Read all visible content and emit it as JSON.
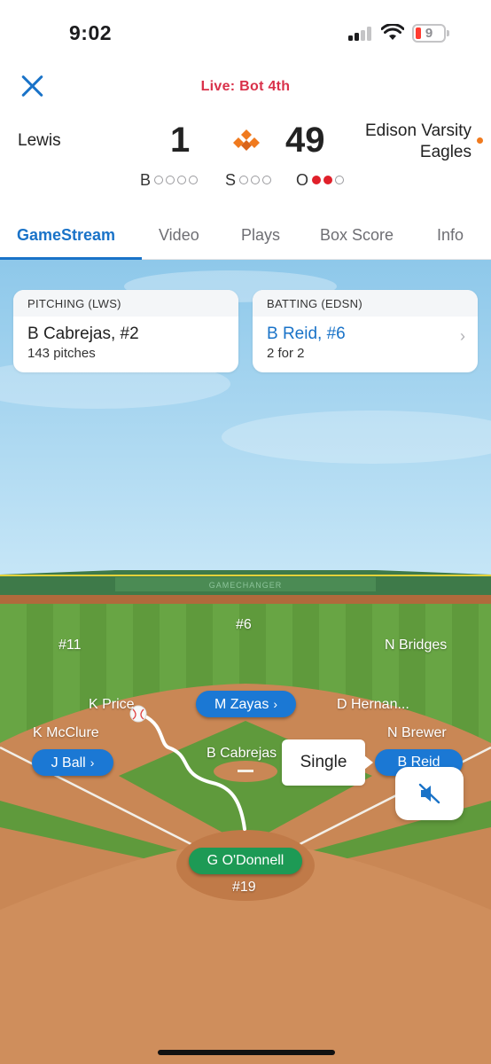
{
  "status_bar": {
    "time": "9:02",
    "battery": "9"
  },
  "header": {
    "live_status": "Live: Bot 4th",
    "away": {
      "name": "Lewis",
      "score": "1"
    },
    "home": {
      "name": "Edison Varsity Eagles",
      "score": "49"
    },
    "count": {
      "balls_label": "B",
      "strikes_label": "S",
      "outs_label": "O",
      "balls": 0,
      "strikes": 0,
      "outs": 2
    }
  },
  "tabs": [
    {
      "label": "GameStream",
      "active": true
    },
    {
      "label": "Video",
      "active": false
    },
    {
      "label": "Plays",
      "active": false
    },
    {
      "label": "Box Score",
      "active": false
    },
    {
      "label": "Info",
      "active": false
    }
  ],
  "pitching_card": {
    "title": "PITCHING (LWS)",
    "player": "B Cabrejas, #2",
    "stat": "143 pitches"
  },
  "batting_card": {
    "title": "BATTING (EDSN)",
    "player": "B Reid, #6",
    "stat": "2 for 2"
  },
  "field": {
    "wall_text": "GAMECHANGER",
    "fielders": {
      "cf": "#6",
      "lf": "#11",
      "rf": "N Bridges",
      "ss": "K Price",
      "tb": "K McClure",
      "second": "D Hernan...",
      "first": "N Brewer",
      "pitcher": "B Cabrejas",
      "catcher": "#19"
    },
    "runners": {
      "second": "M Zayas",
      "third": "J Ball",
      "first": "B Reid"
    },
    "batter": "G O'Donnell",
    "play_result": "Single"
  },
  "icons": {
    "close": "close-icon",
    "logo": "gamechanger-diamond-icon",
    "mute": "speaker-muted-icon",
    "chevron": "chevron-right-icon"
  },
  "colors": {
    "accent": "#1a73c8",
    "live": "#d9314a",
    "runner_pill": "#1b78d4",
    "batter_pill": "#1d9a55",
    "brand_orange": "#f07a1e",
    "out_dot": "#e0202a"
  }
}
